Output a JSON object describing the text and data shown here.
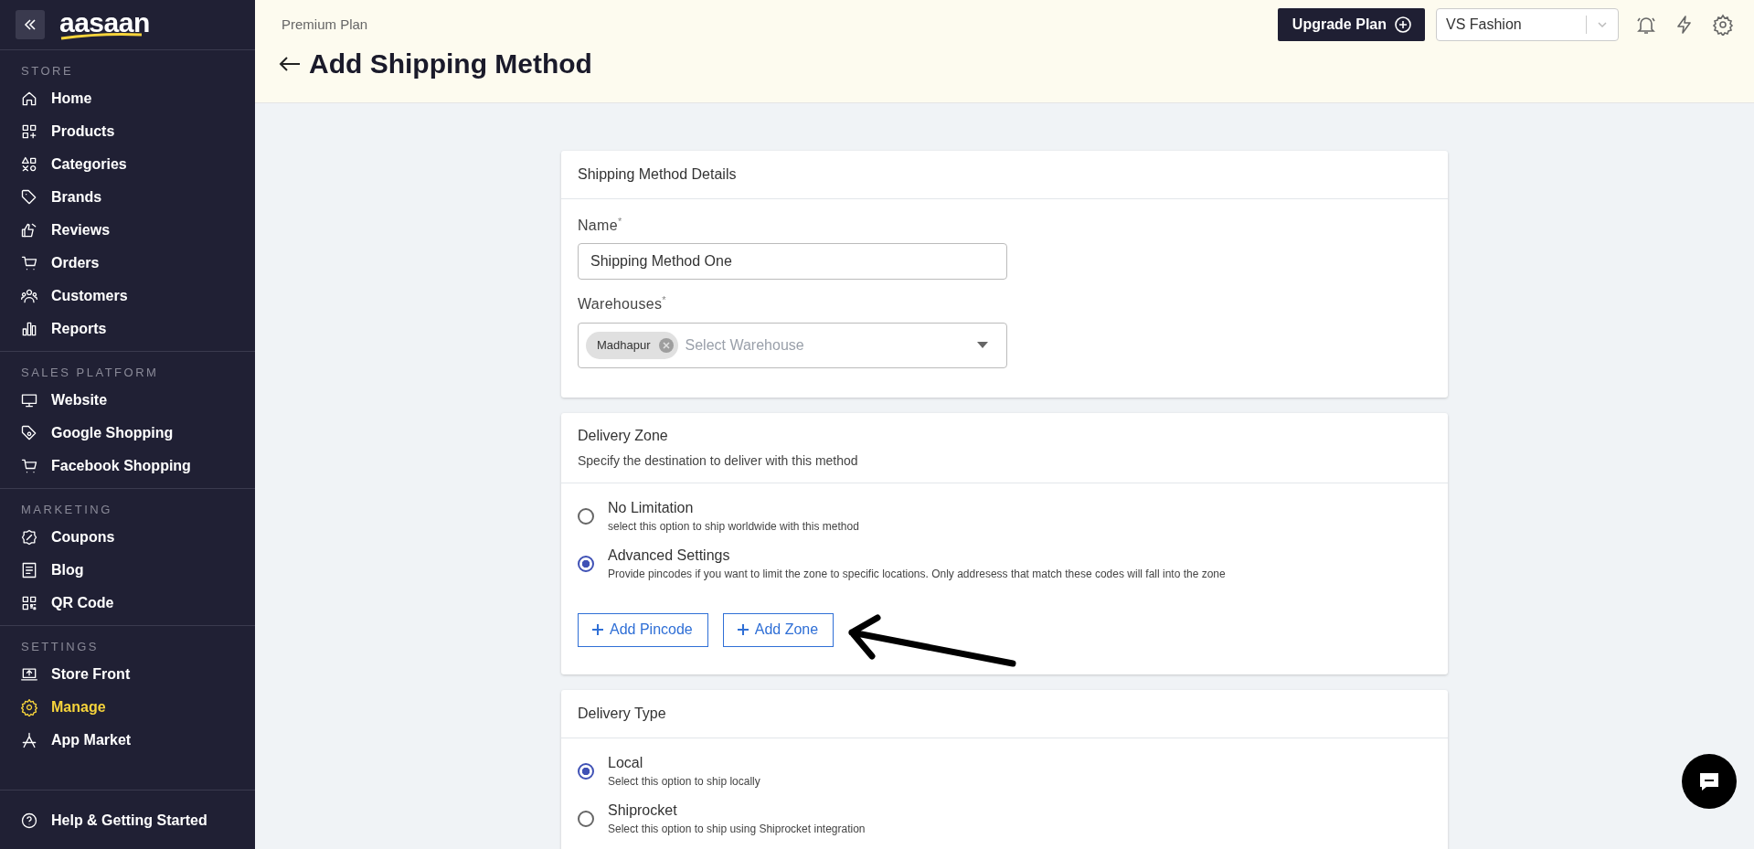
{
  "sidebar": {
    "logo": "aasaan",
    "sections": [
      {
        "heading": "STORE",
        "items": [
          {
            "label": "Home",
            "selected": false
          },
          {
            "label": "Products",
            "selected": false
          },
          {
            "label": "Categories",
            "selected": false
          },
          {
            "label": "Brands",
            "selected": false
          },
          {
            "label": "Reviews",
            "selected": false
          },
          {
            "label": "Orders",
            "selected": false
          },
          {
            "label": "Customers",
            "selected": false
          },
          {
            "label": "Reports",
            "selected": false
          }
        ]
      },
      {
        "heading": "SALES PLATFORM",
        "items": [
          {
            "label": "Website",
            "selected": false
          },
          {
            "label": "Google Shopping",
            "selected": false
          },
          {
            "label": "Facebook Shopping",
            "selected": false
          }
        ]
      },
      {
        "heading": "MARKETING",
        "items": [
          {
            "label": "Coupons",
            "selected": false
          },
          {
            "label": "Blog",
            "selected": false
          },
          {
            "label": "QR Code",
            "selected": false
          }
        ]
      },
      {
        "heading": "SETTINGS",
        "items": [
          {
            "label": "Store Front",
            "selected": false
          },
          {
            "label": "Manage",
            "selected": true
          },
          {
            "label": "App Market",
            "selected": false
          }
        ]
      }
    ],
    "footer_item": {
      "label": "Help & Getting Started"
    }
  },
  "header": {
    "plan": "Premium Plan",
    "upgrade_button": "Upgrade Plan",
    "store_select": "VS Fashion",
    "title": "Add Shipping Method"
  },
  "details_card": {
    "title": "Shipping Method Details",
    "name_label": "Name",
    "name_required_mark": "*",
    "name_value": "Shipping Method One",
    "warehouses_label": "Warehouses",
    "warehouses_required_mark": "*",
    "warehouse_chips": [
      "Madhapur"
    ],
    "warehouse_placeholder": "Select Warehouse"
  },
  "zone_card": {
    "title": "Delivery Zone",
    "subtitle": "Specify the destination to deliver with this method",
    "options": [
      {
        "label": "No Limitation",
        "description": "select this option to ship worldwide with this method",
        "selected": false
      },
      {
        "label": "Advanced Settings",
        "description": "Provide pincodes if you want to limit the zone to specific locations. Only addresess that match these codes will fall into the zone",
        "selected": true
      }
    ],
    "buttons": [
      "Add Pincode",
      "Add Zone"
    ]
  },
  "type_card": {
    "title": "Delivery Type",
    "options": [
      {
        "label": "Local",
        "description": "Select this option to ship locally",
        "selected": true
      },
      {
        "label": "Shiprocket",
        "description": "Select this option to ship using Shiprocket integration",
        "selected": false
      }
    ]
  }
}
